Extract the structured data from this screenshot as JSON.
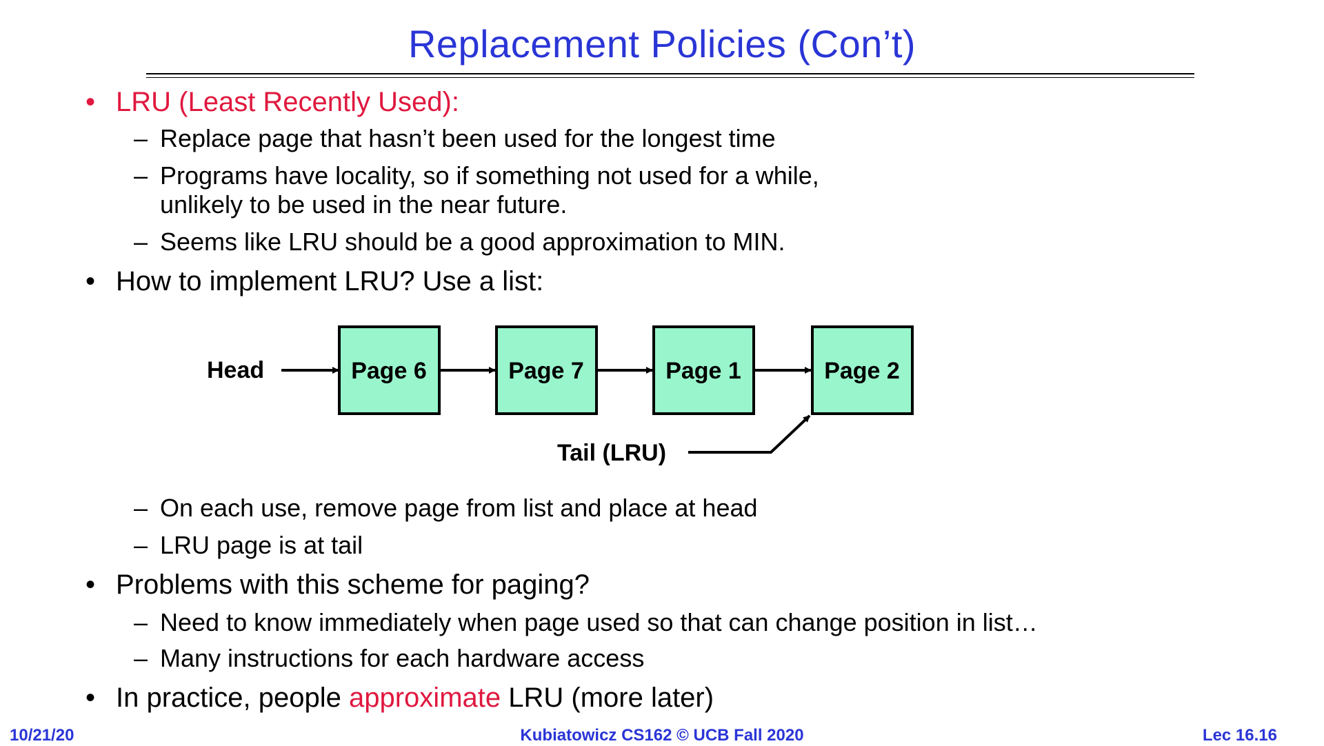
{
  "title": "Replacement Policies (Con’t)",
  "bullets": {
    "b1": "LRU (Least Recently Used):",
    "b1_sub1": "Replace page that hasn’t been used for the longest time",
    "b1_sub2_line1": "Programs have locality, so if something not used for a while,",
    "b1_sub2_line2": "unlikely to be used in the near future.",
    "b1_sub3": "Seems like LRU should be a good approximation to MIN.",
    "b2": "How to implement LRU? Use a list:",
    "b2_sub1": "On each use, remove page from list and place at head",
    "b2_sub2": "LRU page is at tail",
    "b3": "Problems with this scheme for paging?",
    "b3_sub1": "Need to know immediately when page used so that can change position in list…",
    "b3_sub2": "Many instructions for each hardware access",
    "b4_pre": "In practice, people ",
    "b4_highlight": "approximate",
    "b4_post": " LRU (more later)"
  },
  "markers": {
    "bullet": "•",
    "dash": "–"
  },
  "diagram": {
    "head_label": "Head",
    "tail_label": "Tail (LRU)",
    "pages": [
      "Page 6",
      "Page 7",
      "Page 1",
      "Page 2"
    ]
  },
  "footer": {
    "date": "10/21/20",
    "course": "Kubiatowicz CS162 © UCB Fall 2020",
    "lecture": "Lec 16.16"
  },
  "colors": {
    "title": "#2a35d6",
    "highlight": "#e0183f",
    "page_box_fill": "#99f5cc",
    "footer": "#2a35d6"
  }
}
